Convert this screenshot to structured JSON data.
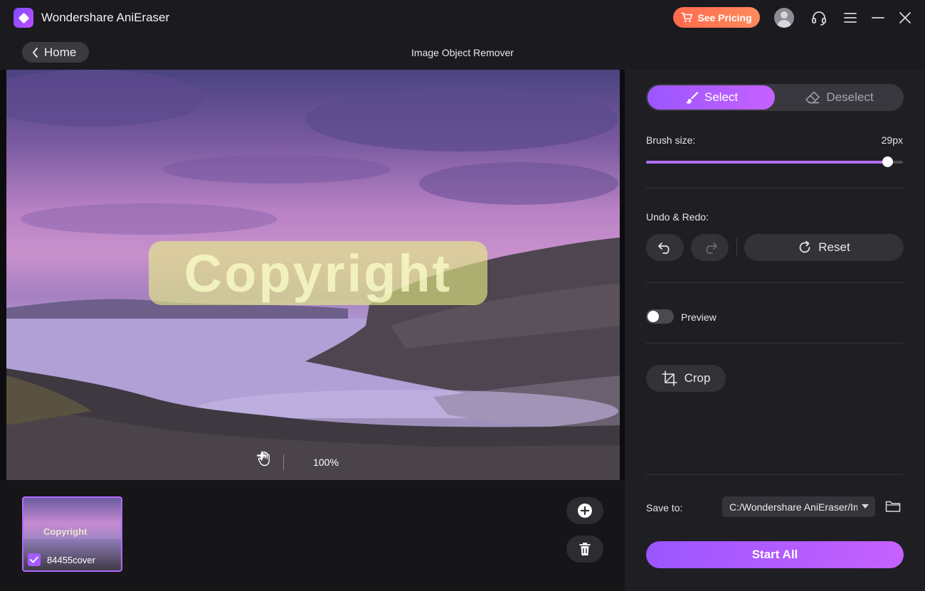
{
  "app": {
    "title": "Wondershare AniEraser",
    "pricing_label": "See Pricing",
    "icons": [
      "app-logo-icon",
      "cart-icon",
      "avatar-icon",
      "headset-icon",
      "menu-icon",
      "minimize-icon",
      "close-icon"
    ]
  },
  "subbar": {
    "home_label": "Home",
    "page_title": "Image Object Remover"
  },
  "canvas": {
    "mask_text": "Copyright",
    "zoom_level": "100%"
  },
  "thumbnails": [
    {
      "name": "84455cover",
      "checked": true,
      "mask_text": "Copyright"
    }
  ],
  "panel": {
    "select_label": "Select",
    "deselect_label": "Deselect",
    "brush_size_label": "Brush size:",
    "brush_size_value": "29px",
    "brush_size_fraction": 0.94,
    "undo_redo_label": "Undo & Redo:",
    "reset_label": "Reset",
    "preview_label": "Preview",
    "preview_on": false,
    "crop_label": "Crop",
    "save_to_label": "Save to:",
    "save_path": "C:/Wondershare AniEraser/Image",
    "start_label": "Start All"
  },
  "colors": {
    "accent": "#a45cff",
    "pricing": "#ff6a4d",
    "background": "#161619",
    "panel": "#1f1f23"
  }
}
